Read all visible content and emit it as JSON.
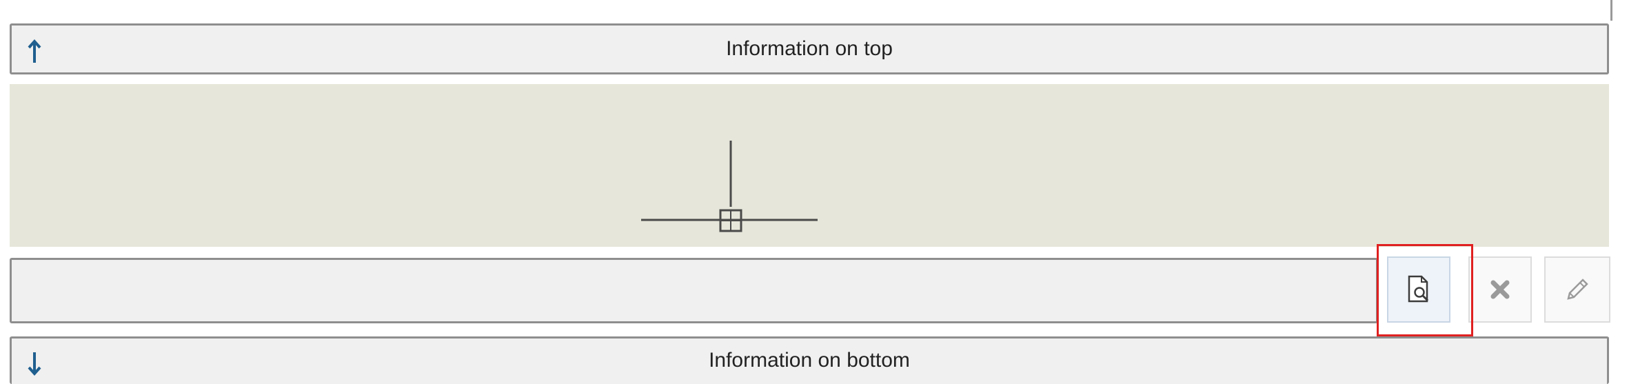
{
  "top_bar": {
    "label": "Information on top",
    "icon": "arrow-up-icon"
  },
  "bottom_bar": {
    "label": "Information on bottom",
    "icon": "arrow-down-icon"
  },
  "viewport": {
    "background_color": "#e6e6da",
    "cursor_icon": "crosshair-cursor-icon"
  },
  "field": {
    "value": ""
  },
  "toolbar": {
    "preview_icon": "document-magnifier-icon",
    "delete_icon": "x-icon",
    "edit_icon": "pencil-icon"
  },
  "colors": {
    "arrow": "#1f5f8f",
    "highlight": "#e02020"
  }
}
